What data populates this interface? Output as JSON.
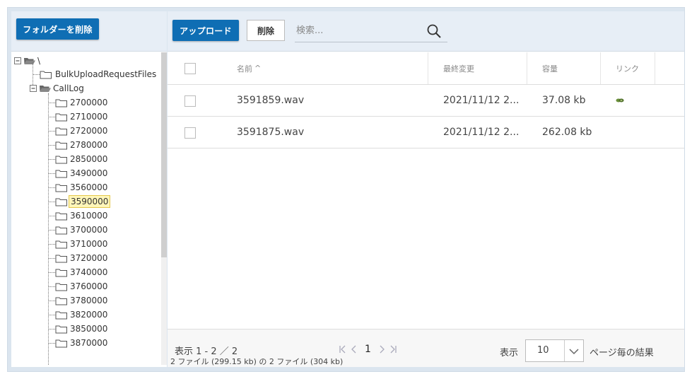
{
  "left": {
    "delete_folder_label": "フォルダーを削除",
    "tree": {
      "root_label": "\\",
      "level1": [
        "BulkUploadRequestFiles",
        "CallLog"
      ],
      "calllog_children": [
        "2700000",
        "2710000",
        "2720000",
        "2780000",
        "2850000",
        "3490000",
        "3560000",
        "3590000",
        "3610000",
        "3700000",
        "3710000",
        "3720000",
        "3740000",
        "3760000",
        "3780000",
        "3820000",
        "3850000",
        "3870000"
      ],
      "selected": "3590000"
    }
  },
  "toolbar": {
    "upload_label": "アップロード",
    "delete_label": "削除",
    "search_placeholder": "検索..."
  },
  "grid": {
    "columns": {
      "name": "名前",
      "modified": "最終変更",
      "size": "容量",
      "link": "リンク"
    },
    "sort_indicator": "^",
    "rows": [
      {
        "name": "3591859.wav",
        "modified": "2021/11/12 2...",
        "size": "37.08 kb",
        "has_link": true
      },
      {
        "name": "3591875.wav",
        "modified": "2021/11/12 2...",
        "size": "262.08 kb",
        "has_link": false
      }
    ]
  },
  "footer": {
    "range_text": "表示 1 - 2 ／ 2",
    "summary_text": "2 ファイル (299.15 kb) の 2 ファイル (304 kb)",
    "current_page": "1",
    "show_label": "表示",
    "page_size": "10",
    "per_page_label": "ページ毎の結果"
  },
  "colors": {
    "accent": "#0f6eb4",
    "panel_header": "#e7eef6",
    "selected_bg": "#fff6b9"
  },
  "icons": [
    "folder-open-icon",
    "folder-icon",
    "minus-box-icon",
    "search-icon",
    "link-icon",
    "first-page-icon",
    "prev-page-icon",
    "next-page-icon",
    "last-page-icon",
    "chevron-down-icon"
  ]
}
